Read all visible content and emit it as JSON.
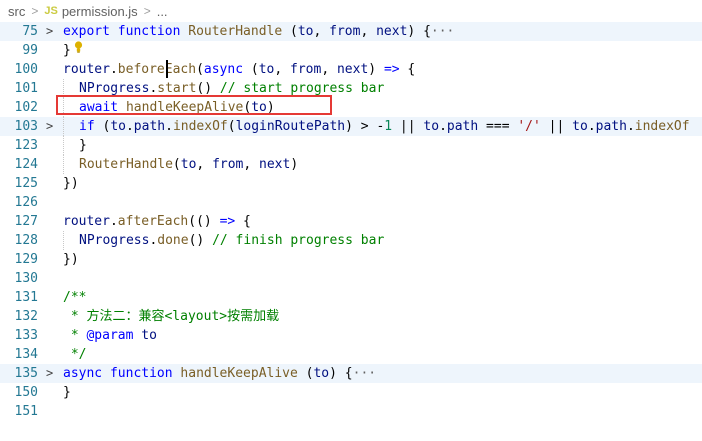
{
  "breadcrumb": {
    "folder": "src",
    "sep1": ">",
    "file_icon": "JS",
    "file": "permission.js",
    "sep2": ">",
    "more": "..."
  },
  "lines": [
    {
      "num": "75",
      "fold": ">",
      "highlight": true,
      "tokens": [
        {
          "c": "kw",
          "t": "export"
        },
        {
          "c": "",
          "t": " "
        },
        {
          "c": "kw",
          "t": "function"
        },
        {
          "c": "",
          "t": " "
        },
        {
          "c": "fn",
          "t": "RouterHandle"
        },
        {
          "c": "",
          "t": " ("
        },
        {
          "c": "id",
          "t": "to"
        },
        {
          "c": "",
          "t": ", "
        },
        {
          "c": "id",
          "t": "from"
        },
        {
          "c": "",
          "t": ", "
        },
        {
          "c": "id",
          "t": "next"
        },
        {
          "c": "",
          "t": ") {"
        },
        {
          "c": "ell",
          "t": "···"
        }
      ]
    },
    {
      "num": "99",
      "fold": "",
      "highlight": false,
      "tokens": [
        {
          "c": "",
          "t": "}"
        }
      ]
    },
    {
      "num": "100",
      "fold": "",
      "highlight": false,
      "tokens": [
        {
          "c": "id",
          "t": "router"
        },
        {
          "c": "",
          "t": "."
        },
        {
          "c": "fn",
          "t": "beforeEach"
        },
        {
          "c": "",
          "t": "("
        },
        {
          "c": "kw",
          "t": "async"
        },
        {
          "c": "",
          "t": " ("
        },
        {
          "c": "id",
          "t": "to"
        },
        {
          "c": "",
          "t": ", "
        },
        {
          "c": "id",
          "t": "from"
        },
        {
          "c": "",
          "t": ", "
        },
        {
          "c": "id",
          "t": "next"
        },
        {
          "c": "",
          "t": ") "
        },
        {
          "c": "kw",
          "t": "=>"
        },
        {
          "c": "",
          "t": " {"
        }
      ]
    },
    {
      "num": "101",
      "fold": "",
      "highlight": false,
      "indent": 1,
      "tokens": [
        {
          "c": "id",
          "t": "NProgress"
        },
        {
          "c": "",
          "t": "."
        },
        {
          "c": "fn",
          "t": "start"
        },
        {
          "c": "",
          "t": "() "
        },
        {
          "c": "cm",
          "t": "// start progress bar"
        }
      ]
    },
    {
      "num": "102",
      "fold": "",
      "highlight": false,
      "indent": 1,
      "tokens": [
        {
          "c": "kw",
          "t": "await"
        },
        {
          "c": "",
          "t": " "
        },
        {
          "c": "fn",
          "t": "handleKeepAlive"
        },
        {
          "c": "",
          "t": "("
        },
        {
          "c": "id",
          "t": "to"
        },
        {
          "c": "",
          "t": ")"
        }
      ]
    },
    {
      "num": "103",
      "fold": ">",
      "highlight": true,
      "indent": 1,
      "tokens": [
        {
          "c": "kw",
          "t": "if"
        },
        {
          "c": "",
          "t": " ("
        },
        {
          "c": "id",
          "t": "to"
        },
        {
          "c": "",
          "t": "."
        },
        {
          "c": "id",
          "t": "path"
        },
        {
          "c": "",
          "t": "."
        },
        {
          "c": "fn",
          "t": "indexOf"
        },
        {
          "c": "",
          "t": "("
        },
        {
          "c": "id",
          "t": "loginRoutePath"
        },
        {
          "c": "",
          "t": ") > -"
        },
        {
          "c": "num",
          "t": "1"
        },
        {
          "c": "",
          "t": " || "
        },
        {
          "c": "id",
          "t": "to"
        },
        {
          "c": "",
          "t": "."
        },
        {
          "c": "id",
          "t": "path"
        },
        {
          "c": "",
          "t": " === "
        },
        {
          "c": "str",
          "t": "'/'"
        },
        {
          "c": "",
          "t": " || "
        },
        {
          "c": "id",
          "t": "to"
        },
        {
          "c": "",
          "t": "."
        },
        {
          "c": "id",
          "t": "path"
        },
        {
          "c": "",
          "t": "."
        },
        {
          "c": "fn",
          "t": "indexOf"
        }
      ]
    },
    {
      "num": "123",
      "fold": "",
      "highlight": false,
      "indent": 1,
      "tokens": [
        {
          "c": "",
          "t": "}"
        }
      ]
    },
    {
      "num": "124",
      "fold": "",
      "highlight": false,
      "indent": 1,
      "tokens": [
        {
          "c": "fn",
          "t": "RouterHandle"
        },
        {
          "c": "",
          "t": "("
        },
        {
          "c": "id",
          "t": "to"
        },
        {
          "c": "",
          "t": ", "
        },
        {
          "c": "id",
          "t": "from"
        },
        {
          "c": "",
          "t": ", "
        },
        {
          "c": "id",
          "t": "next"
        },
        {
          "c": "",
          "t": ")"
        }
      ]
    },
    {
      "num": "125",
      "fold": "",
      "highlight": false,
      "tokens": [
        {
          "c": "",
          "t": "})"
        }
      ]
    },
    {
      "num": "126",
      "fold": "",
      "highlight": false,
      "tokens": []
    },
    {
      "num": "127",
      "fold": "",
      "highlight": false,
      "tokens": [
        {
          "c": "id",
          "t": "router"
        },
        {
          "c": "",
          "t": "."
        },
        {
          "c": "fn",
          "t": "afterEach"
        },
        {
          "c": "",
          "t": "(() "
        },
        {
          "c": "kw",
          "t": "=>"
        },
        {
          "c": "",
          "t": " {"
        }
      ]
    },
    {
      "num": "128",
      "fold": "",
      "highlight": false,
      "indent": 1,
      "tokens": [
        {
          "c": "id",
          "t": "NProgress"
        },
        {
          "c": "",
          "t": "."
        },
        {
          "c": "fn",
          "t": "done"
        },
        {
          "c": "",
          "t": "() "
        },
        {
          "c": "cm",
          "t": "// finish progress bar"
        }
      ]
    },
    {
      "num": "129",
      "fold": "",
      "highlight": false,
      "tokens": [
        {
          "c": "",
          "t": "})"
        }
      ]
    },
    {
      "num": "130",
      "fold": "",
      "highlight": false,
      "tokens": []
    },
    {
      "num": "131",
      "fold": "",
      "highlight": false,
      "tokens": [
        {
          "c": "cm",
          "t": "/**"
        }
      ]
    },
    {
      "num": "132",
      "fold": "",
      "highlight": false,
      "indent": 0,
      "tokens": [
        {
          "c": "cm",
          "t": " * 方法二：兼容<layout>按需加载"
        }
      ]
    },
    {
      "num": "133",
      "fold": "",
      "highlight": false,
      "tokens": [
        {
          "c": "cm",
          "t": " * "
        },
        {
          "c": "doc",
          "t": "@param"
        },
        {
          "c": "",
          "t": " "
        },
        {
          "c": "id",
          "t": "to"
        }
      ]
    },
    {
      "num": "134",
      "fold": "",
      "highlight": false,
      "tokens": [
        {
          "c": "cm",
          "t": " */"
        }
      ]
    },
    {
      "num": "135",
      "fold": ">",
      "highlight": true,
      "tokens": [
        {
          "c": "kw",
          "t": "async"
        },
        {
          "c": "",
          "t": " "
        },
        {
          "c": "kw",
          "t": "function"
        },
        {
          "c": "",
          "t": " "
        },
        {
          "c": "fn",
          "t": "handleKeepAlive"
        },
        {
          "c": "",
          "t": " ("
        },
        {
          "c": "id",
          "t": "to"
        },
        {
          "c": "",
          "t": ") {"
        },
        {
          "c": "ell",
          "t": "···"
        }
      ]
    },
    {
      "num": "150",
      "fold": "",
      "highlight": false,
      "tokens": [
        {
          "c": "",
          "t": "}"
        }
      ]
    },
    {
      "num": "151",
      "fold": "",
      "highlight": false,
      "tokens": []
    }
  ]
}
